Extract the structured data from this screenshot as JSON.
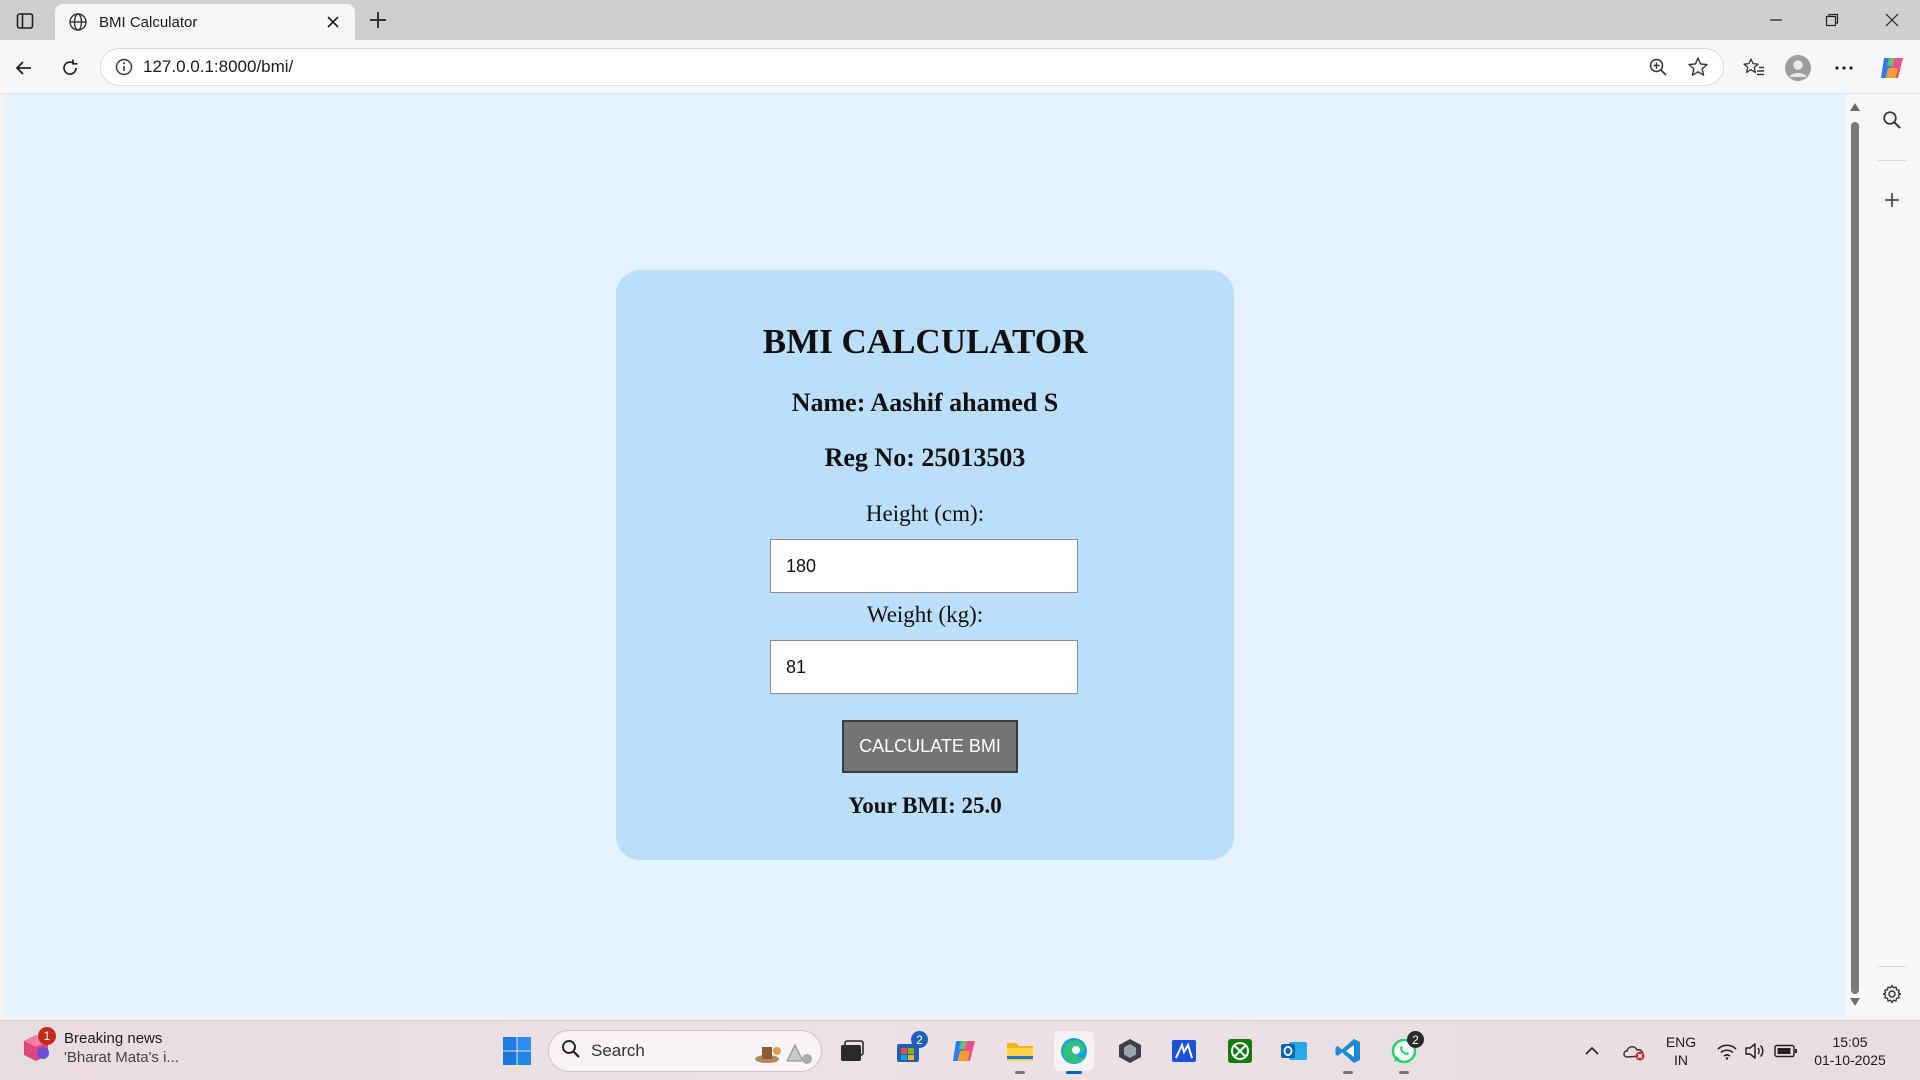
{
  "browser": {
    "tab_title": "BMI Calculator",
    "url": "127.0.0.1:8000/bmi/"
  },
  "page": {
    "title": "BMI CALCULATOR",
    "name_line": "Name: Aashif ahamed S",
    "reg_line": "Reg No: 25013503",
    "height_label": "Height (cm):",
    "height_value": "180",
    "weight_label": "Weight (kg):",
    "weight_value": "81",
    "button_label": "CALCULATE BMI",
    "result_line": "Your BMI: 25.0"
  },
  "taskbar": {
    "news_title": "Breaking news",
    "news_subtitle": "'Bharat Mata's i...",
    "news_badge": "1",
    "search_label": "Search",
    "store_badge": "2",
    "whatsapp_badge": "2",
    "lang_top": "ENG",
    "lang_bottom": "IN",
    "time": "15:05",
    "date": "01-10-2025"
  },
  "colors": {
    "page_background": "#e3f2fd",
    "card_background": "#bbdefb",
    "button_background": "#757575"
  }
}
